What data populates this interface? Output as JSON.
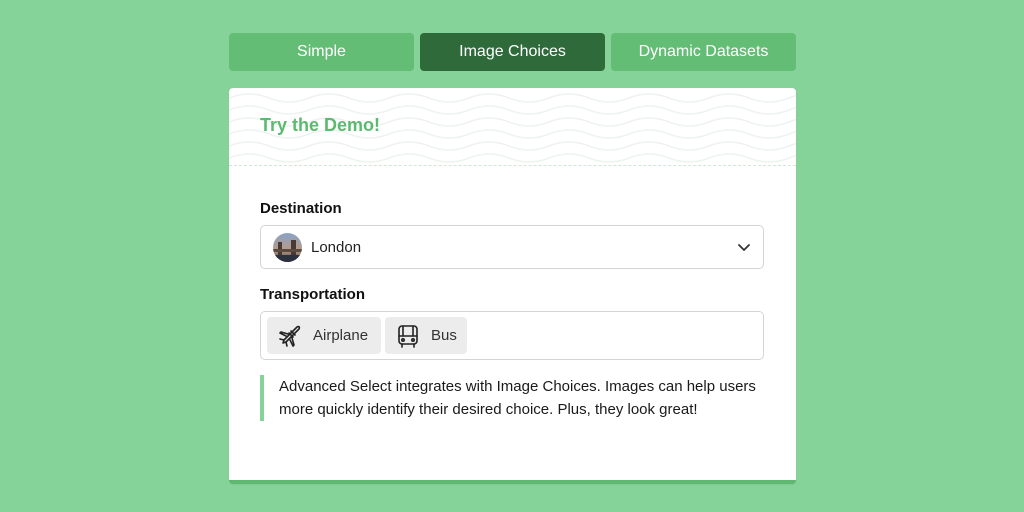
{
  "tabs": [
    {
      "label": "Simple",
      "active": false
    },
    {
      "label": "Image Choices",
      "active": true
    },
    {
      "label": "Dynamic Datasets",
      "active": false
    }
  ],
  "card": {
    "title": "Try the Demo!",
    "destination": {
      "label": "Destination",
      "value": "London",
      "icon": "chevron-down-icon"
    },
    "transportation": {
      "label": "Transportation",
      "options": [
        {
          "label": "Airplane",
          "icon": "airplane-icon"
        },
        {
          "label": "Bus",
          "icon": "bus-icon"
        }
      ]
    },
    "note": "Advanced Select integrates with Image Choices. Images can help users more quickly identify their desired choice. Plus, they look great!"
  },
  "colors": {
    "background": "#86d39a",
    "tab": "#63bd75",
    "tab_active": "#2f6b3a",
    "accent": "#5cba70"
  }
}
